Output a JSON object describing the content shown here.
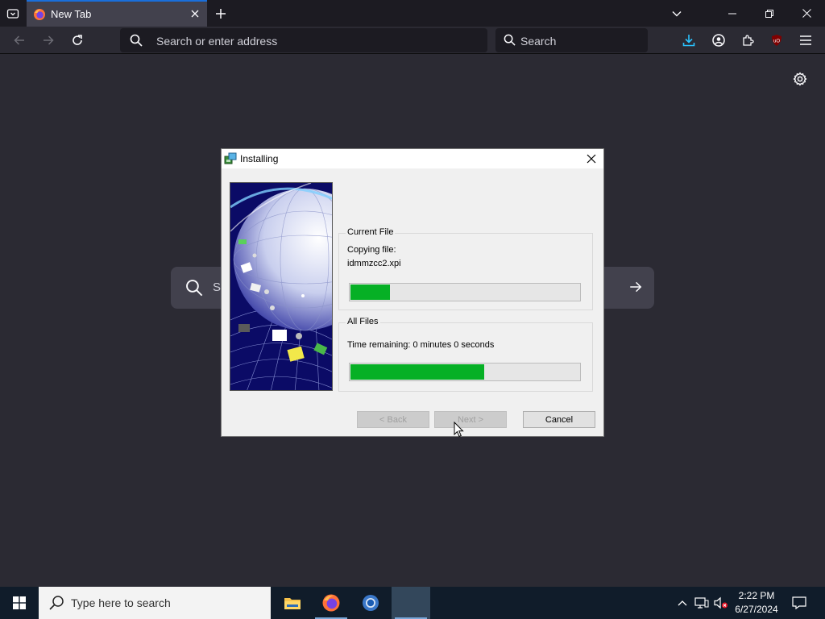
{
  "browser": {
    "tab": {
      "title": "New Tab"
    },
    "urlbar": {
      "placeholder": "Search or enter address"
    },
    "searchbar": {
      "placeholder": "Search"
    },
    "ntp_search": {
      "placeholder": "S"
    }
  },
  "dialog": {
    "title": "Installing",
    "current_file": {
      "legend": "Current File",
      "action": "Copying file:",
      "filename": "idmmzcc2.xpi",
      "progress": 0.17
    },
    "all_files": {
      "legend": "All Files",
      "time_remaining": "Time remaining: 0 minutes 0 seconds",
      "progress": 0.58
    },
    "buttons": {
      "back": "< Back",
      "next": "Next >",
      "cancel": "Cancel"
    }
  },
  "taskbar": {
    "search_placeholder": "Type here to search",
    "time": "2:22 PM",
    "date": "6/27/2024"
  },
  "colors": {
    "progress_fill": "#06b025",
    "accent": "#1a6fdb",
    "ublock": "#800000"
  }
}
